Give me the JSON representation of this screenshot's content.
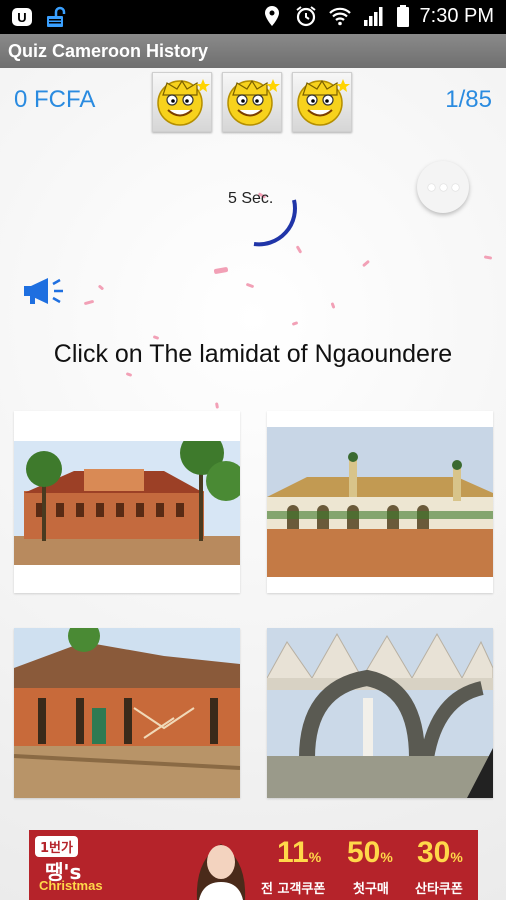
{
  "status": {
    "time": "7:30 PM"
  },
  "appbar": {
    "title": "Quiz Cameroon History"
  },
  "header": {
    "money": "0 FCFA",
    "counter": "1/85"
  },
  "timer": {
    "label": "5 Sec.",
    "progress": 0.25
  },
  "question": {
    "text": "Click on The lamidat of Ngaoundere"
  },
  "ad": {
    "badge": "1번가",
    "brand": "땡's",
    "subtitle": "Christmas",
    "offers": [
      {
        "value": "11",
        "unit": "%",
        "label": "전 고객쿠폰"
      },
      {
        "value": "50",
        "unit": "%",
        "label": "첫구매"
      },
      {
        "value": "30",
        "unit": "%",
        "label": "산타쿠폰"
      }
    ]
  }
}
